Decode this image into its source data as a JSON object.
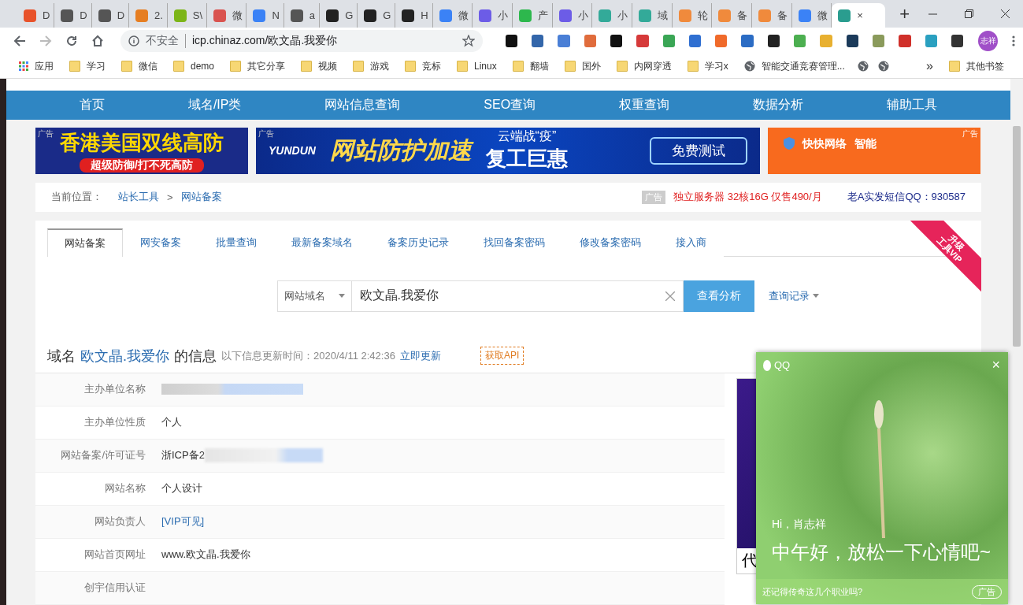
{
  "browser": {
    "tabs": [
      {
        "title": "D",
        "color": "#e8522a",
        "selected": false
      },
      {
        "title": "D",
        "color": "#555555",
        "selected": false
      },
      {
        "title": "D",
        "color": "#555555",
        "selected": false
      },
      {
        "title": "2.",
        "color": "#e67e22",
        "selected": false
      },
      {
        "title": "S\\",
        "color": "#7cb518",
        "selected": false
      },
      {
        "title": "微",
        "color": "#d9534f",
        "selected": false
      },
      {
        "title": "N",
        "color": "#3b82f6",
        "selected": false
      },
      {
        "title": "a",
        "color": "#555555",
        "selected": false
      },
      {
        "title": "G",
        "color": "#222222",
        "selected": false
      },
      {
        "title": "G",
        "color": "#222222",
        "selected": false
      },
      {
        "title": "H",
        "color": "#222222",
        "selected": false
      },
      {
        "title": "微",
        "color": "#3b82f6",
        "selected": false
      },
      {
        "title": "小",
        "color": "#6c5ce7",
        "selected": false
      },
      {
        "title": "产",
        "color": "#2db84d",
        "selected": false
      },
      {
        "title": "小",
        "color": "#6c5ce7",
        "selected": false
      },
      {
        "title": "小",
        "color": "#33aa99",
        "selected": false
      },
      {
        "title": "域",
        "color": "#33aa99",
        "selected": false
      },
      {
        "title": "轮",
        "color": "#f08a3c",
        "selected": false
      },
      {
        "title": "备",
        "color": "#f08a3c",
        "selected": false
      },
      {
        "title": "备",
        "color": "#f08a3c",
        "selected": false
      },
      {
        "title": "微",
        "color": "#3b82f6",
        "selected": false
      },
      {
        "title": "×",
        "color": "#2a9d8f",
        "selected": true
      }
    ],
    "new_tab": "+",
    "address": {
      "security": "不安全",
      "url": "icp.chinaz.com/欧文晶.我爱你"
    },
    "extensions": [
      {
        "color": "#111111"
      },
      {
        "color": "#3366aa"
      },
      {
        "color": "#4a7fd6"
      },
      {
        "color": "#e06c3c"
      },
      {
        "color": "#111111"
      },
      {
        "color": "#d63a3a"
      },
      {
        "color": "#3aa655"
      },
      {
        "color": "#2f6fd1"
      },
      {
        "color": "#f06a2a"
      },
      {
        "color": "#2b6cc4"
      },
      {
        "color": "#222222"
      },
      {
        "color": "#4caf50"
      },
      {
        "color": "#e8b030"
      },
      {
        "color": "#1b3a5a"
      },
      {
        "color": "#8a9a5b"
      },
      {
        "color": "#d0302a"
      },
      {
        "color": "#2aa0c0"
      },
      {
        "color": "#333333"
      }
    ],
    "profile": "志祥",
    "bookmarks": [
      {
        "label": "应用",
        "kind": "apps"
      },
      {
        "label": "学习",
        "kind": "folder"
      },
      {
        "label": "微信",
        "kind": "folder"
      },
      {
        "label": "demo",
        "kind": "folder"
      },
      {
        "label": "其它分享",
        "kind": "folder"
      },
      {
        "label": "视频",
        "kind": "folder"
      },
      {
        "label": "游戏",
        "kind": "folder"
      },
      {
        "label": "竞标",
        "kind": "folder"
      },
      {
        "label": "Linux",
        "kind": "folder"
      },
      {
        "label": "翻墙",
        "kind": "folder"
      },
      {
        "label": "国外",
        "kind": "folder"
      },
      {
        "label": "内网穿透",
        "kind": "folder"
      },
      {
        "label": "学习x",
        "kind": "folder"
      },
      {
        "label": "智能交通竞赛管理...",
        "kind": "globe"
      },
      {
        "kind": "globe"
      },
      {
        "kind": "globe"
      }
    ],
    "more": "»",
    "other_bookmarks": "其他书签"
  },
  "nav": [
    "首页",
    "域名/IP类",
    "网站信息查询",
    "SEO查询",
    "权重查询",
    "数据分析",
    "辅助工具"
  ],
  "ads": {
    "left": {
      "title": "香港美国双线高防",
      "subtitle": "超级防御/打不死高防",
      "tag": "广告"
    },
    "middle": {
      "logo": "YUNDUN",
      "title": "网站防护加速",
      "slogan": "云端战“疫”",
      "offer": "复工巨惠",
      "button": "免费测试",
      "tag": "广告"
    },
    "right": {
      "brand": "快快网络",
      "title": "智能",
      "tag": "广告"
    }
  },
  "breadcrumb": {
    "label": "当前位置：",
    "items": [
      "站长工具",
      "网站备案"
    ],
    "separator": ">",
    "ad_tag": "广告",
    "promo": "独立服务器 32核16G 仅售490/月",
    "contact": "老A实发短信QQ：930587"
  },
  "tool_tabs": [
    {
      "label": "网站备案",
      "selected": true
    },
    {
      "label": "网安备案",
      "selected": false
    },
    {
      "label": "批量查询",
      "selected": false
    },
    {
      "label": "最新备案域名",
      "selected": false
    },
    {
      "label": "备案历史记录",
      "selected": false
    },
    {
      "label": "找回备案密码",
      "selected": false
    },
    {
      "label": "修改备案密码",
      "selected": false
    },
    {
      "label": "接入商",
      "selected": false
    }
  ],
  "vip_ribbon": {
    "line1": "升级",
    "line2": "工具VIP"
  },
  "search": {
    "type": "网站域名",
    "value": "欧文晶.我爱你",
    "button": "查看分析",
    "history": "查询记录"
  },
  "info": {
    "prefix": "域名",
    "domain": "欧文晶.我爱你",
    "suffix": "的信息",
    "updated_label": "以下信息更新时间：",
    "updated": "2020/4/11 2:42:36",
    "refresh": "立即更新",
    "api": "获取API",
    "rows": [
      {
        "label": "主办单位名称",
        "kind": "redacted"
      },
      {
        "label": "主办单位性质",
        "value": "个人",
        "kind": "text"
      },
      {
        "label": "网站备案/许可证号",
        "value": "浙ICP备2",
        "kind": "partial"
      },
      {
        "label": "网站名称",
        "value": "个人设计",
        "kind": "text"
      },
      {
        "label": "网站负责人",
        "value": "[VIP可见]",
        "kind": "link"
      },
      {
        "label": "网站首页网址",
        "value": "www.欧文晶.我爱你",
        "kind": "text"
      },
      {
        "label": "创宇信用认证",
        "kind": "empty"
      }
    ]
  },
  "side_ad": {
    "text": "代"
  },
  "popup": {
    "brand": "QQ",
    "close": "×",
    "greeting": "Hi，肖志祥",
    "message": "中午好，放松一下心情吧~",
    "footer": "还记得传奇这几个职业吗?",
    "tag": "广告"
  }
}
